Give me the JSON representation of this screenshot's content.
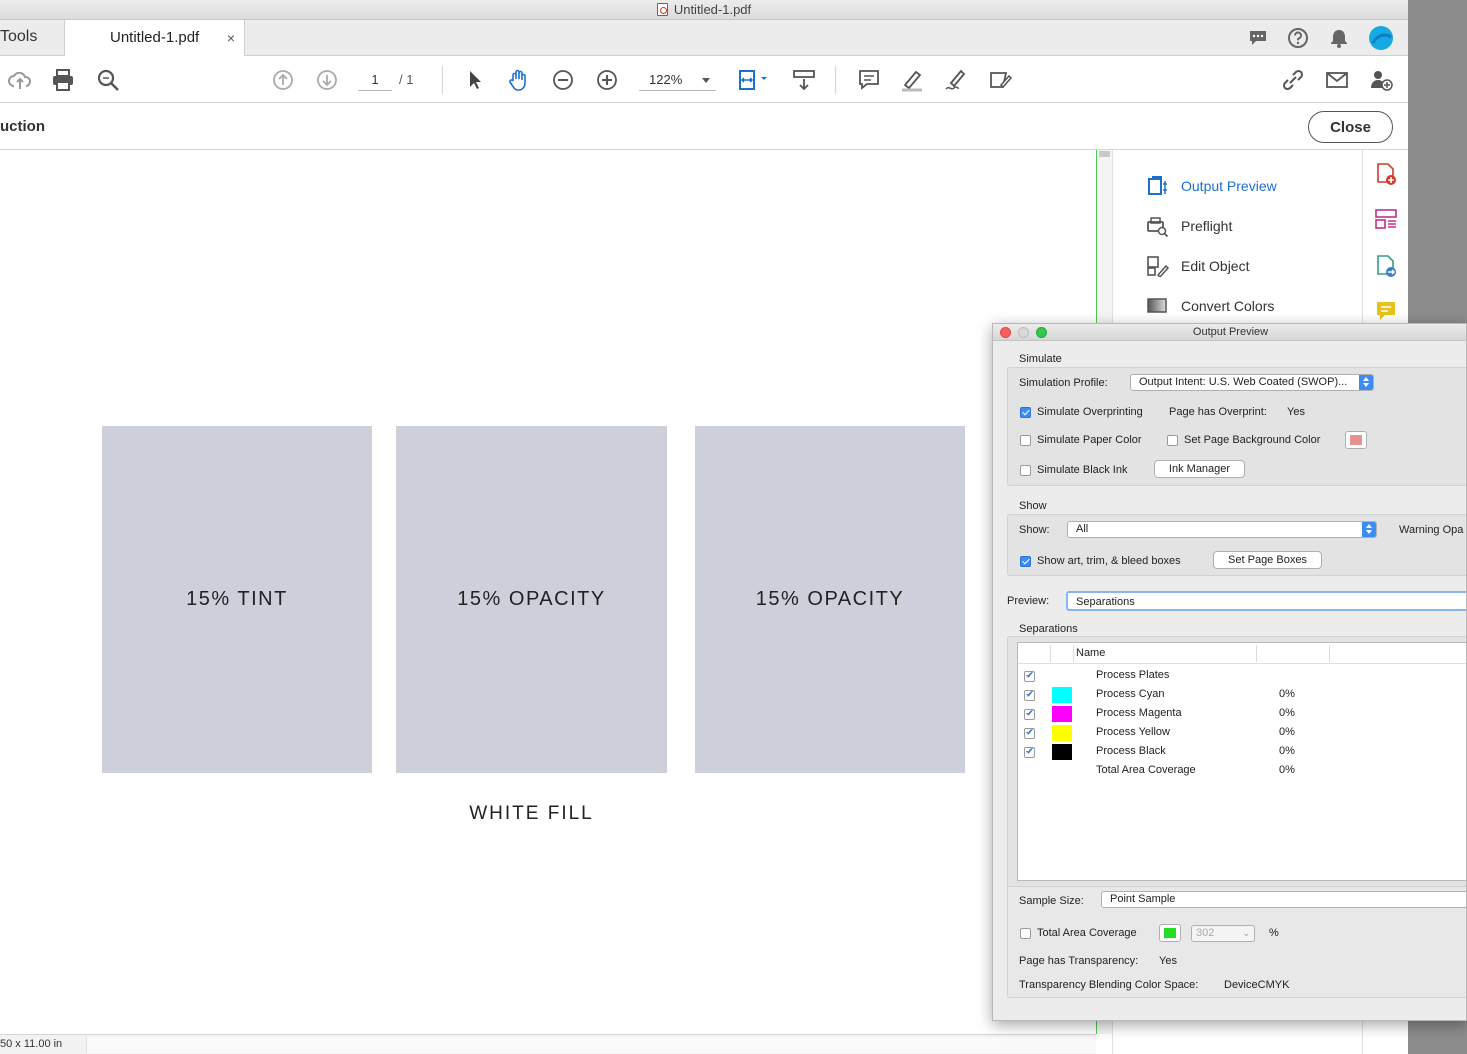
{
  "window": {
    "title": "Untitled-1.pdf"
  },
  "tabs": {
    "tools": "Tools",
    "document": "Untitled-1.pdf",
    "close": "×"
  },
  "toolbar": {
    "page_current": "1",
    "page_total": "/ 1",
    "zoom": "122%"
  },
  "tool_header": {
    "title": "uction",
    "close_label": "Close"
  },
  "document": {
    "boxes": [
      "15% TINT",
      "15% OPACITY",
      "15% OPACITY"
    ],
    "caption": "WHITE FILL",
    "box_color": "#cdcfdb"
  },
  "status": {
    "page_size": "50 x 11.00 in"
  },
  "right_panel": {
    "items": [
      {
        "label": "Output Preview",
        "icon": "output-preview-icon",
        "active": true
      },
      {
        "label": "Preflight",
        "icon": "preflight-icon"
      },
      {
        "label": "Edit Object",
        "icon": "edit-object-icon"
      },
      {
        "label": "Convert Colors",
        "icon": "convert-colors-icon"
      }
    ]
  },
  "right_rail": {
    "icons": [
      "create-pdf-icon",
      "organize-pages-icon",
      "export-pdf-icon",
      "comment-icon"
    ]
  },
  "dialog": {
    "title": "Output Preview",
    "simulate": {
      "section": "Simulate",
      "profile_label": "Simulation Profile:",
      "profile_value": "Output Intent: U.S. Web Coated (SWOP)...",
      "overprinting": {
        "label": "Simulate Overprinting",
        "checked": true
      },
      "has_overprint_label": "Page has Overprint:",
      "has_overprint_value": "Yes",
      "paper_color": {
        "label": "Simulate Paper Color",
        "checked": false
      },
      "page_bg": {
        "label": "Set Page Background Color",
        "checked": false
      },
      "bg_swatch_color": "#e89090",
      "black_ink": {
        "label": "Simulate Black Ink",
        "checked": false
      },
      "ink_manager": "Ink Manager"
    },
    "show": {
      "section": "Show",
      "show_label": "Show:",
      "show_value": "All",
      "warning_label": "Warning Opa",
      "boxes": {
        "label": "Show art, trim, & bleed boxes",
        "checked": true
      },
      "set_page_boxes": "Set Page Boxes"
    },
    "preview": {
      "label": "Preview:",
      "value": "Separations"
    },
    "separations": {
      "section": "Separations",
      "col_name": "Name",
      "rows": [
        {
          "name": "Process Plates",
          "color": "",
          "value": "",
          "checked": true
        },
        {
          "name": "Process Cyan",
          "color": "#00ffff",
          "value": "0%",
          "checked": true
        },
        {
          "name": "Process Magenta",
          "color": "#ff00ff",
          "value": "0%",
          "checked": true
        },
        {
          "name": "Process Yellow",
          "color": "#ffff00",
          "value": "0%",
          "checked": true
        },
        {
          "name": "Process Black",
          "color": "#000000",
          "value": "0%",
          "checked": true
        },
        {
          "name": "Total Area Coverage",
          "color": "",
          "value": "0%",
          "checked": null
        }
      ]
    },
    "sample": {
      "label": "Sample Size:",
      "value": "Point Sample"
    },
    "tac": {
      "label": "Total Area Coverage",
      "checked": false,
      "swatch": "#22dd22",
      "value": "302",
      "unit": "%"
    },
    "transparency": {
      "label": "Page has Transparency:",
      "value": "Yes"
    },
    "blending": {
      "label": "Transparency Blending Color Space:",
      "value": "DeviceCMYK"
    }
  }
}
